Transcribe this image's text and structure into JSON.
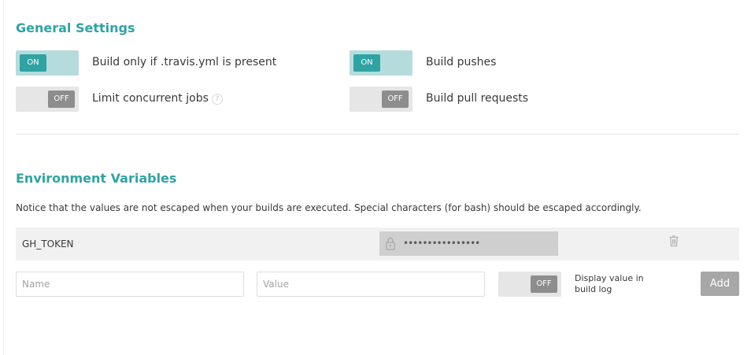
{
  "general": {
    "title": "General Settings",
    "settings": [
      {
        "label": "Build only if .travis.yml is present",
        "state": "ON"
      },
      {
        "label": "Build pushes",
        "state": "ON"
      },
      {
        "label": "Limit concurrent jobs",
        "state": "OFF",
        "help": "?"
      },
      {
        "label": "Build pull requests",
        "state": "OFF"
      }
    ]
  },
  "env": {
    "title": "Environment Variables",
    "notice": "Notice that the values are not escaped when your builds are executed. Special characters (for bash) should be escaped accordingly.",
    "variables": [
      {
        "name": "GH_TOKEN",
        "value_mask": "••••••••••••••••"
      }
    ],
    "new": {
      "name_placeholder": "Name",
      "value_placeholder": "Value",
      "display_state": "OFF",
      "display_label": "Display value in build log",
      "add_label": "Add"
    }
  },
  "colors": {
    "accent": "#2fa3a3",
    "toggle_on_track": "#b5dcdc",
    "toggle_off_knob": "#8d8d8d"
  },
  "icons": [
    "help-icon",
    "lock-icon",
    "trash-icon"
  ]
}
